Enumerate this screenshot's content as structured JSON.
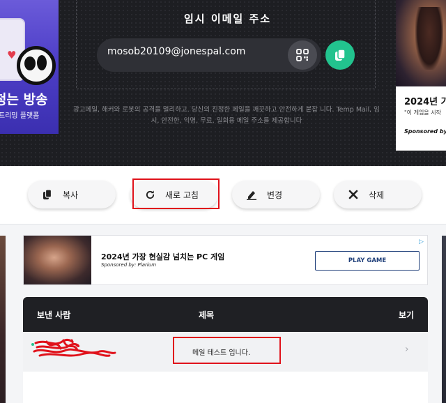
{
  "header": {
    "title": "임시 이메일 주소",
    "email": "mosob20109@jonespal.com",
    "description": "광고메일, 해커와 로봇의 공격을 멀리하고. 당신의 진정한 메일을 깨끗하고 안전하게 붙잡 니다. Temp Mail, 임시, 안전한, 익명, 무료, 일회용 메일 주소를 제공합니다"
  },
  "left_ad": {
    "headline": "청는 방송",
    "subline": "트리밍 플랫폼"
  },
  "right_ad": {
    "title": "2024년 가",
    "quote": "\"이 게임을 시작",
    "sponsor": "Sponsored by"
  },
  "actions": {
    "copy": "복사",
    "refresh": "새로 고침",
    "change": "변경",
    "delete": "삭제"
  },
  "banner_ad": {
    "title": "2024년 가장 현실감 넘치는 PC 게임",
    "sponsor": "Sponsored by: Plarium",
    "cta": "PLAY GAME"
  },
  "inbox": {
    "col_sender": "보낸 사람",
    "col_subject": "제목",
    "col_view": "보기",
    "messages": [
      {
        "subject": "메일 테스트 입니다."
      }
    ]
  },
  "colors": {
    "header_bg": "#1d1e22",
    "accent_green": "#22c38e",
    "highlight_red": "#e0121b"
  }
}
